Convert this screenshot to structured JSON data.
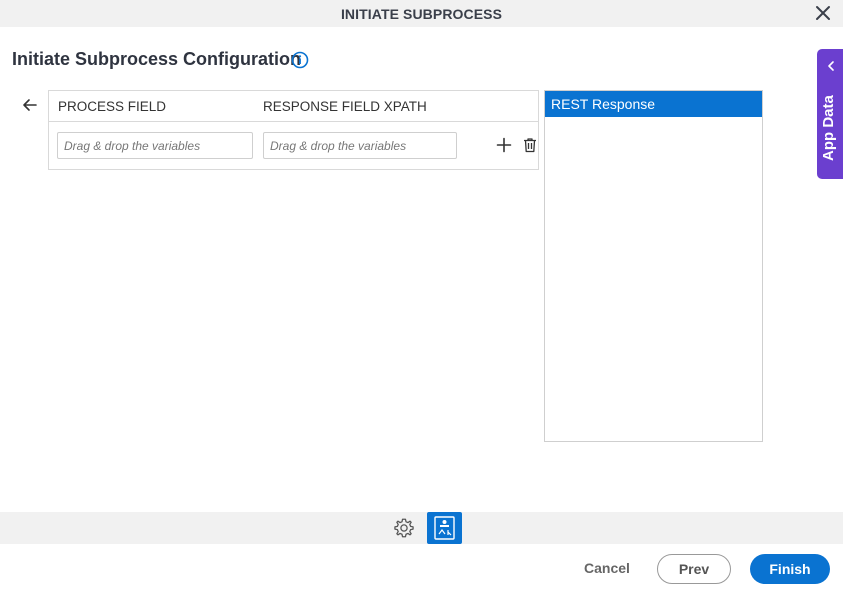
{
  "dialog": {
    "title": "INITIATE SUBPROCESS",
    "heading": "Initiate Subprocess Configuration"
  },
  "mapping": {
    "columns": [
      "PROCESS FIELD",
      "RESPONSE FIELD XPATH"
    ],
    "rows": [
      {
        "process_field_placeholder": "Drag & drop the variables",
        "xpath_placeholder": "Drag & drop the variables"
      }
    ]
  },
  "rest_panel": {
    "items": [
      "REST Response"
    ]
  },
  "side_tab": {
    "label": "App Data"
  },
  "footer": {
    "cancel": "Cancel",
    "prev": "Prev",
    "finish": "Finish"
  },
  "icons": {
    "close": "close-icon",
    "info": "info-icon",
    "back": "arrow-left-icon",
    "add": "plus-icon",
    "delete": "trash-icon",
    "settings": "gear-icon",
    "mapping": "rest-mapping-icon",
    "collapse": "chevron-left-icon"
  },
  "colors": {
    "accent": "#0a73d1",
    "side_tab": "#6b3fcf",
    "toolbar_bg": "#f1f1f1"
  }
}
